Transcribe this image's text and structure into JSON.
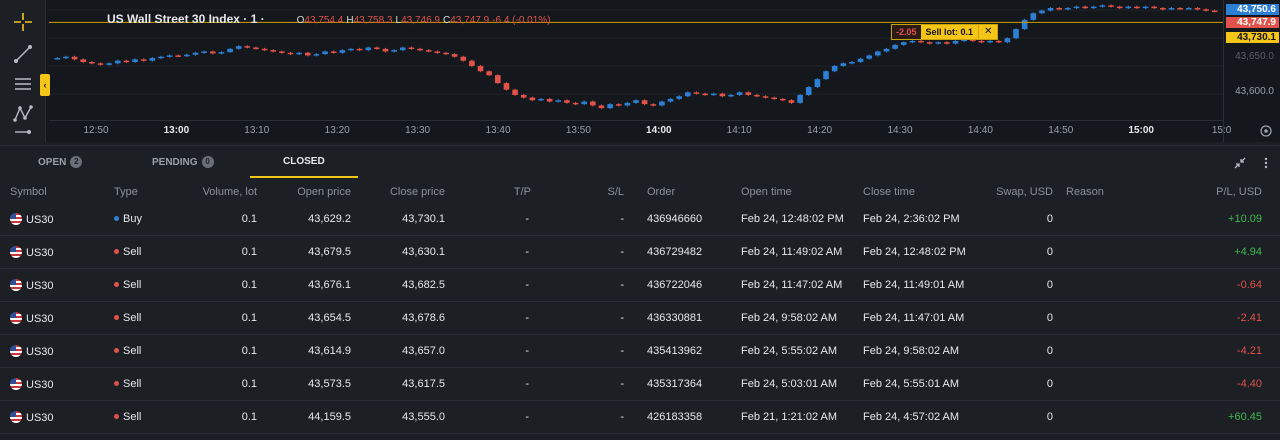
{
  "header": {
    "instrument_title": "US Wall Street 30 Index · 1 ·",
    "ohlc": [
      {
        "key": "O",
        "value": "43,754.4"
      },
      {
        "key": "H",
        "value": "43,758.3"
      },
      {
        "key": "L",
        "value": "43,746.9"
      },
      {
        "key": "C",
        "value": "43,747.9"
      },
      {
        "key": "",
        "value": "-6.4 (-0.01%)"
      }
    ]
  },
  "toolbar": {
    "tools": [
      {
        "icon": "crosshair-icon"
      },
      {
        "icon": "trend-line-icon"
      },
      {
        "icon": "horizontal-lines-icon"
      },
      {
        "icon": "pattern-icon"
      },
      {
        "icon": "measure-icon"
      }
    ],
    "collapse_label": "‹"
  },
  "order_line": {
    "pl": "-2.05",
    "label": "Sell lot: 0.1",
    "close_glyph": "✕",
    "price": 43730.1
  },
  "price_axis": {
    "ticks": [
      "43,600.0"
    ],
    "tags": [
      {
        "label": "43,750.6",
        "color": "#2d7fd3",
        "text_color": "#ffffff"
      },
      {
        "label": "43,747.9",
        "color": "#e0524a",
        "text_color": "#ffffff"
      },
      {
        "label": "43,730.1",
        "color": "#f5c518",
        "text_color": "#111111"
      }
    ]
  },
  "time_axis": {
    "ticks": [
      {
        "label": "12:50",
        "bold": false
      },
      {
        "label": "13:00",
        "bold": true
      },
      {
        "label": "13:10",
        "bold": false
      },
      {
        "label": "13:20",
        "bold": false
      },
      {
        "label": "13:30",
        "bold": false
      },
      {
        "label": "13:40",
        "bold": false
      },
      {
        "label": "13:50",
        "bold": false
      },
      {
        "label": "14:00",
        "bold": true
      },
      {
        "label": "14:10",
        "bold": false
      },
      {
        "label": "14:20",
        "bold": false
      },
      {
        "label": "14:30",
        "bold": false
      },
      {
        "label": "14:40",
        "bold": false
      },
      {
        "label": "14:50",
        "bold": false
      },
      {
        "label": "15:00",
        "bold": true
      },
      {
        "label": "15:0",
        "bold": false
      }
    ]
  },
  "chart_data": {
    "type": "candlestick",
    "up_color": "#2d7fd3",
    "down_color": "#e0524a",
    "ylim": [
      43585,
      43755
    ],
    "candles": [
      43676,
      43678,
      43674,
      43670,
      43668,
      43666,
      43668,
      43672,
      43670,
      43674,
      43672,
      43676,
      43678,
      43680,
      43679,
      43681,
      43684,
      43686,
      43683,
      43685,
      43690,
      43694,
      43692,
      43690,
      43688,
      43686,
      43684,
      43682,
      43684,
      43680,
      43682,
      43686,
      43684,
      43688,
      43690,
      43688,
      43692,
      43690,
      43686,
      43688,
      43692,
      43690,
      43688,
      43686,
      43684,
      43682,
      43678,
      43672,
      43664,
      43656,
      43650,
      43638,
      43628,
      43620,
      43616,
      43612,
      43614,
      43610,
      43612,
      43608,
      43606,
      43610,
      43604,
      43600,
      43606,
      43604,
      43608,
      43612,
      43606,
      43604,
      43610,
      43614,
      43618,
      43624,
      43622,
      43620,
      43622,
      43618,
      43620,
      43624,
      43620,
      43618,
      43616,
      43614,
      43612,
      43608,
      43620,
      43632,
      43644,
      43656,
      43664,
      43668,
      43670,
      43675,
      43680,
      43686,
      43690,
      43696,
      43700,
      43702,
      43700,
      43698,
      43700,
      43698,
      43702,
      43704,
      43702,
      43700,
      43702,
      43700,
      43706,
      43720,
      43734,
      43744,
      43748,
      43752,
      43750,
      43752,
      43754,
      43752,
      43754,
      43756,
      43754,
      43752,
      43754,
      43752,
      43754,
      43752,
      43750,
      43752,
      43751,
      43752,
      43750,
      43748,
      43747
    ]
  },
  "positions": {
    "tabs": [
      {
        "label": "OPEN",
        "count": "2"
      },
      {
        "label": "PENDING",
        "count": "0"
      },
      {
        "label": "CLOSED",
        "count": ""
      }
    ],
    "active_tab": "CLOSED",
    "columns": [
      "Symbol",
      "Type",
      "Volume, lot",
      "Open price",
      "Close price",
      "T/P",
      "S/L",
      "Order",
      "Open time",
      "Close time",
      "Swap, USD",
      "Reason",
      "P/L, USD"
    ],
    "rows": [
      {
        "symbol": "US30",
        "type": "Buy",
        "volume": "0.1",
        "open_price": "43,629.2",
        "close_price": "43,730.1",
        "tp": "-",
        "sl": "-",
        "order": "436946660",
        "open_time": "Feb 24, 12:48:02 PM",
        "close_time": "Feb 24, 2:36:02 PM",
        "swap": "0",
        "reason": "",
        "pl": "+10.09"
      },
      {
        "symbol": "US30",
        "type": "Sell",
        "volume": "0.1",
        "open_price": "43,679.5",
        "close_price": "43,630.1",
        "tp": "-",
        "sl": "-",
        "order": "436729482",
        "open_time": "Feb 24, 11:49:02 AM",
        "close_time": "Feb 24, 12:48:02 PM",
        "swap": "0",
        "reason": "",
        "pl": "+4.94"
      },
      {
        "symbol": "US30",
        "type": "Sell",
        "volume": "0.1",
        "open_price": "43,676.1",
        "close_price": "43,682.5",
        "tp": "-",
        "sl": "-",
        "order": "436722046",
        "open_time": "Feb 24, 11:47:02 AM",
        "close_time": "Feb 24, 11:49:01 AM",
        "swap": "0",
        "reason": "",
        "pl": "-0.64"
      },
      {
        "symbol": "US30",
        "type": "Sell",
        "volume": "0.1",
        "open_price": "43,654.5",
        "close_price": "43,678.6",
        "tp": "-",
        "sl": "-",
        "order": "436330881",
        "open_time": "Feb 24, 9:58:02 AM",
        "close_time": "Feb 24, 11:47:01 AM",
        "swap": "0",
        "reason": "",
        "pl": "-2.41"
      },
      {
        "symbol": "US30",
        "type": "Sell",
        "volume": "0.1",
        "open_price": "43,614.9",
        "close_price": "43,657.0",
        "tp": "-",
        "sl": "-",
        "order": "435413962",
        "open_time": "Feb 24, 5:55:02 AM",
        "close_time": "Feb 24, 9:58:02 AM",
        "swap": "0",
        "reason": "",
        "pl": "-4.21"
      },
      {
        "symbol": "US30",
        "type": "Sell",
        "volume": "0.1",
        "open_price": "43,573.5",
        "close_price": "43,617.5",
        "tp": "-",
        "sl": "-",
        "order": "435317364",
        "open_time": "Feb 24, 5:03:01 AM",
        "close_time": "Feb 24, 5:55:01 AM",
        "swap": "0",
        "reason": "",
        "pl": "-4.40"
      },
      {
        "symbol": "US30",
        "type": "Sell",
        "volume": "0.1",
        "open_price": "44,159.5",
        "close_price": "43,555.0",
        "tp": "-",
        "sl": "-",
        "order": "426183358",
        "open_time": "Feb 21, 1:21:02 AM",
        "close_time": "Feb 24, 4:57:02 AM",
        "swap": "0",
        "reason": "",
        "pl": "+60.45"
      }
    ],
    "colors": {
      "buy": "#2d7fd3",
      "sell": "#e0524a",
      "profit": "#3fb950",
      "loss": "#e0524a"
    }
  }
}
